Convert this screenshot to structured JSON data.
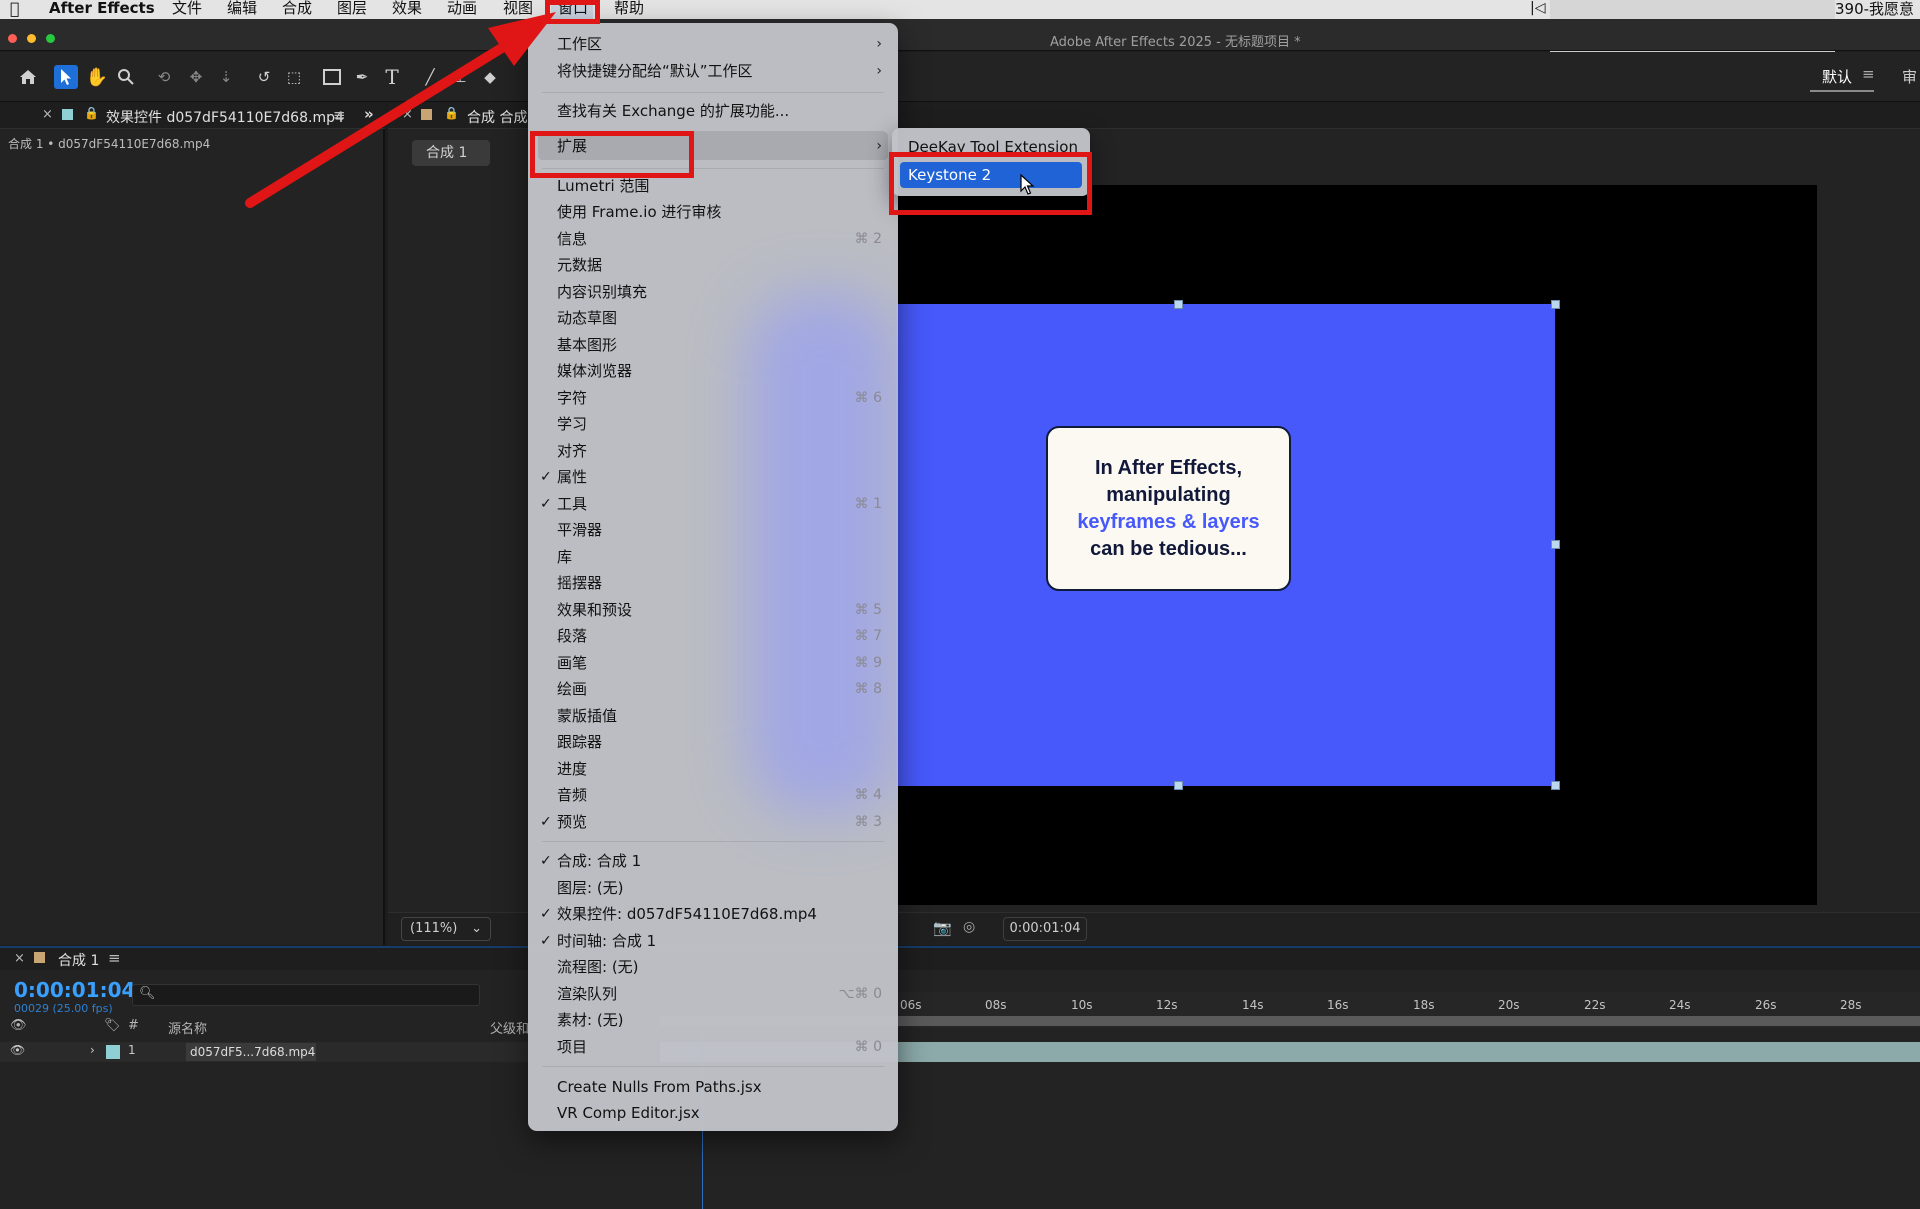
{
  "menubar": {
    "apple_icon": "apple-icon",
    "app_name": "After Effects",
    "items": [
      "文件",
      "编辑",
      "合成",
      "图层",
      "效果",
      "动画",
      "视图",
      "窗口",
      "帮助"
    ],
    "right_text": "390-我愿意"
  },
  "titlebar": {
    "title": "Adobe After Effects 2025 - 无标题项目 *"
  },
  "workspace": {
    "default_label": "默认",
    "review_label": "审"
  },
  "left_panel": {
    "tab_label": "效果控件 d057dF54110E7d68.mp4",
    "subtitle": "合成 1 • d057dF54110E7d68.mp4"
  },
  "comp_panel": {
    "tab_label": "合成 合成",
    "chip_label": "合成 1",
    "card_line1": "In After Effects,",
    "card_line2": "manipulating",
    "card_highlight": "keyframes & layers",
    "card_line4": "can be tedious...",
    "zoom": "(111%)",
    "timecode": "0:00:01:04"
  },
  "timeline": {
    "tab_label": "合成 1",
    "current_time": "0:00:01:04",
    "fps": "00029 (25.00 fps)",
    "col_hash": "#",
    "col_source": "源名称",
    "col_parent": "父级和",
    "layer_index": "1",
    "layer_name": "d057dF5...7d68.mp4",
    "ticks": [
      "06s",
      "08s",
      "10s",
      "12s",
      "14s",
      "16s",
      "18s",
      "20s",
      "22s",
      "24s",
      "26s",
      "28s"
    ]
  },
  "menu": {
    "items": [
      {
        "label": "工作区",
        "submenu": true
      },
      {
        "label": "将快捷键分配给“默认”工作区",
        "submenu": true
      },
      {
        "label": "查找有关 Exchange 的扩展功能..."
      },
      {
        "label": "扩展",
        "submenu": true
      },
      {
        "label": "Lumetri 范围"
      },
      {
        "label": "使用 Frame.io 进行审核"
      },
      {
        "label": "信息",
        "shortcut": "⌘ 2"
      },
      {
        "label": "元数据"
      },
      {
        "label": "内容识别填充"
      },
      {
        "label": "动态草图"
      },
      {
        "label": "基本图形"
      },
      {
        "label": "媒体浏览器"
      },
      {
        "label": "字符",
        "shortcut": "⌘ 6"
      },
      {
        "label": "学习"
      },
      {
        "label": "对齐"
      },
      {
        "label": "属性",
        "checked": true
      },
      {
        "label": "工具",
        "checked": true,
        "shortcut": "⌘ 1"
      },
      {
        "label": "平滑器"
      },
      {
        "label": "库"
      },
      {
        "label": "摇摆器"
      },
      {
        "label": "效果和预设",
        "shortcut": "⌘ 5"
      },
      {
        "label": "段落",
        "shortcut": "⌘ 7"
      },
      {
        "label": "画笔",
        "shortcut": "⌘ 9"
      },
      {
        "label": "绘画",
        "shortcut": "⌘ 8"
      },
      {
        "label": "蒙版插值"
      },
      {
        "label": "跟踪器"
      },
      {
        "label": "进度"
      },
      {
        "label": "音频",
        "shortcut": "⌘ 4"
      },
      {
        "label": "预览",
        "checked": true,
        "shortcut": "⌘ 3"
      },
      {
        "label": "合成: 合成 1",
        "checked": true
      },
      {
        "label": "图层: (无)"
      },
      {
        "label": "效果控件: d057dF54110E7d68.mp4",
        "checked": true
      },
      {
        "label": "时间轴: 合成 1",
        "checked": true
      },
      {
        "label": "流程图: (无)"
      },
      {
        "label": "渲染队列",
        "shortcut": "⌥⌘ 0"
      },
      {
        "label": "素材: (无)"
      },
      {
        "label": "项目",
        "shortcut": "⌘ 0"
      },
      {
        "label": "Create Nulls From Paths.jsx"
      },
      {
        "label": "VR Comp Editor.jsx"
      }
    ]
  },
  "submenu": {
    "items": [
      "DeeKay Tool Extension",
      "Keystone 2"
    ],
    "selected": "Keystone 2"
  },
  "annotation": {
    "color": "#e01515"
  },
  "colors": {
    "accent": "#1f63d6",
    "comp_bg": "#4759fb",
    "timecode": "#3aa0ff"
  }
}
